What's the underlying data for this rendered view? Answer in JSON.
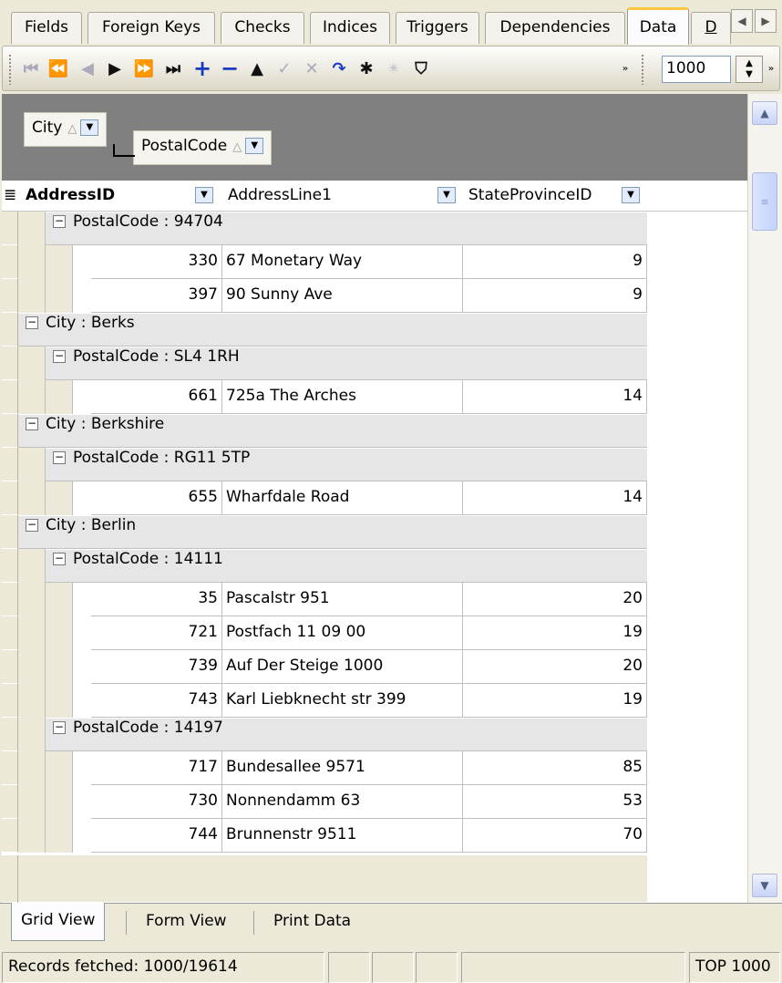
{
  "tabs": [
    {
      "label": "Fields",
      "active": false
    },
    {
      "label": "Foreign Keys",
      "active": false
    },
    {
      "label": "Checks",
      "active": false
    },
    {
      "label": "Indices",
      "active": false
    },
    {
      "label": "Triggers",
      "active": false
    },
    {
      "label": "Dependencies",
      "active": false
    },
    {
      "label": "Data",
      "active": true
    },
    {
      "label": "D",
      "active": false
    }
  ],
  "toolbar": {
    "buttons": [
      "first-record",
      "prior-page",
      "prior-record",
      "next-record",
      "next-page",
      "last-record",
      "insert",
      "delete",
      "edit",
      "post",
      "cancel",
      "refresh",
      "bookmark",
      "goto-bookmark",
      "filter"
    ],
    "records_value": "1000"
  },
  "group_panel": {
    "groups": [
      "City",
      "PostalCode"
    ]
  },
  "columns": [
    "AddressID",
    "AddressLine1",
    "StateProvinceID"
  ],
  "rows": [
    {
      "kind": "group2",
      "text": "PostalCode : 94704"
    },
    {
      "kind": "data",
      "id": "330",
      "addr": "67 Monetary Way",
      "state": "9"
    },
    {
      "kind": "data",
      "id": "397",
      "addr": "90 Sunny Ave",
      "state": "9"
    },
    {
      "kind": "group1",
      "text": "City : Berks"
    },
    {
      "kind": "group2",
      "text": "PostalCode : SL4 1RH"
    },
    {
      "kind": "data",
      "id": "661",
      "addr": "725a The Arches",
      "state": "14"
    },
    {
      "kind": "group1",
      "text": "City : Berkshire"
    },
    {
      "kind": "group2",
      "text": "PostalCode : RG11 5TP"
    },
    {
      "kind": "data",
      "id": "655",
      "addr": "Wharfdale Road",
      "state": "14"
    },
    {
      "kind": "group1",
      "text": "City : Berlin"
    },
    {
      "kind": "group2",
      "text": "PostalCode : 14111"
    },
    {
      "kind": "data",
      "id": "35",
      "addr": "Pascalstr 951",
      "state": "20"
    },
    {
      "kind": "data",
      "id": "721",
      "addr": "Postfach 11 09 00",
      "state": "19"
    },
    {
      "kind": "data",
      "id": "739",
      "addr": "Auf Der Steige 1000",
      "state": "20"
    },
    {
      "kind": "data",
      "id": "743",
      "addr": "Karl Liebknecht str 399",
      "state": "19"
    },
    {
      "kind": "group2",
      "text": "PostalCode : 14197"
    },
    {
      "kind": "data",
      "id": "717",
      "addr": "Bundesallee 9571",
      "state": "85"
    },
    {
      "kind": "data",
      "id": "730",
      "addr": "Nonnendamm 63",
      "state": "53"
    },
    {
      "kind": "data",
      "id": "744",
      "addr": "Brunnenstr 9511",
      "state": "70"
    }
  ],
  "view_tabs": [
    {
      "label": "Grid View",
      "active": true
    },
    {
      "label": "Form View",
      "active": false
    },
    {
      "label": "Print Data",
      "active": false
    }
  ],
  "status": {
    "records": "Records fetched: 1000/19614",
    "top": "TOP 1000"
  }
}
